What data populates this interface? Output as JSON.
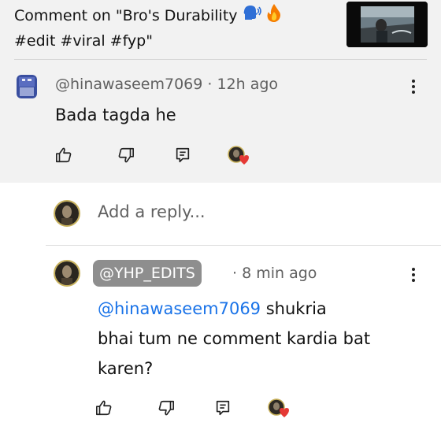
{
  "header": {
    "title_line1": "Comment on \"Bro's Durability",
    "title_line2": "#edit #viral #fyp\"",
    "emoji_speaking_head": "🗣",
    "emoji_fire": "🔥"
  },
  "parent_comment": {
    "handle": "@hinawaseem7069",
    "separator": "·",
    "time": "12h ago",
    "text": "Bada tagda he"
  },
  "reply_box": {
    "placeholder": "Add a reply..."
  },
  "reply_comment": {
    "handle": "@YHP_EDITS",
    "separator": "·",
    "time": "8 min ago",
    "mention": "@hinawaseem7069",
    "text_line1": "shukria",
    "text_line2": "bhai tum ne comment kardia bat",
    "text_line3": "karen?"
  },
  "icons": {
    "like": "thumbs-up-icon",
    "dislike": "thumbs-down-icon",
    "reply": "reply-icon",
    "creator_heart": "creator-heart-icon",
    "more": "more-vert-icon"
  },
  "colors": {
    "accent_link": "#1a73e8",
    "heart": "#e53935",
    "chip": "#8e8e8e"
  }
}
